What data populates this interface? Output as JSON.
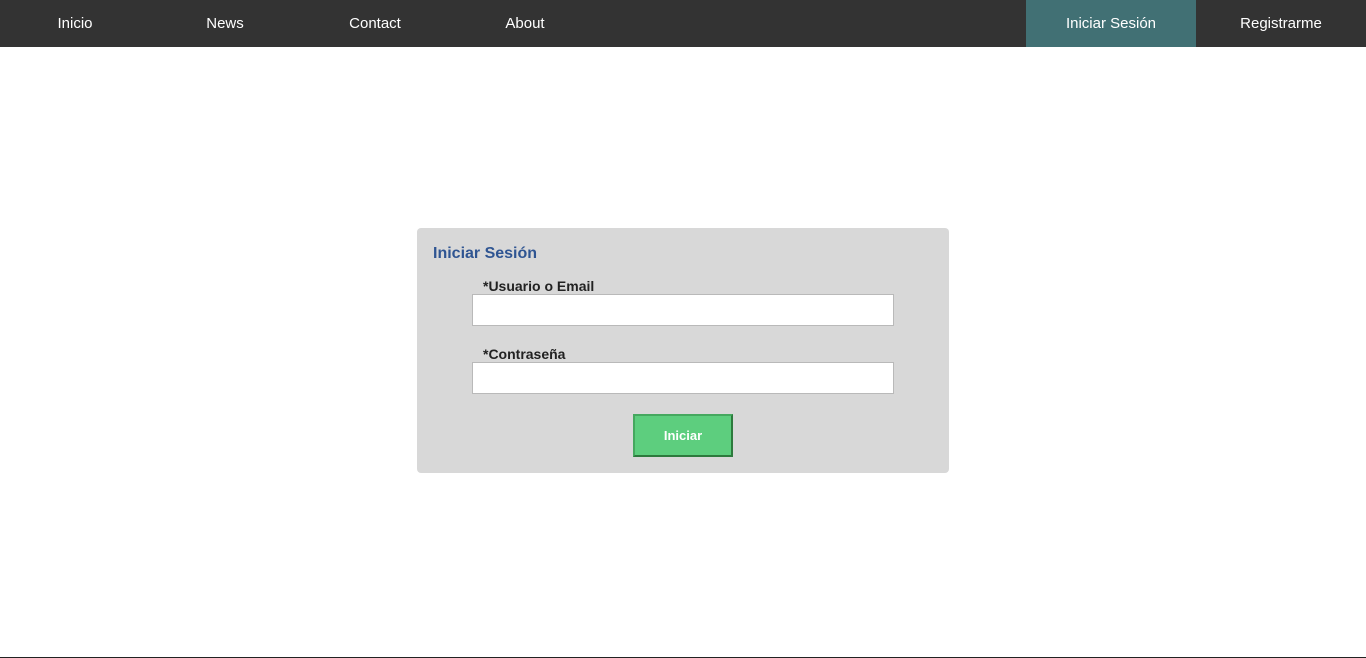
{
  "nav": {
    "left_items": [
      {
        "label": "Inicio"
      },
      {
        "label": "News"
      },
      {
        "label": "Contact"
      },
      {
        "label": "About"
      }
    ],
    "right_items": [
      {
        "label": "Iniciar Sesión",
        "active": true
      },
      {
        "label": "Registrarme",
        "active": false
      }
    ]
  },
  "login": {
    "title": "Iniciar Sesión",
    "user_label": "*Usuario o Email",
    "user_value": "",
    "password_label": "*Contraseña",
    "password_value": "",
    "submit_label": "Iniciar"
  },
  "colors": {
    "nav_bg": "#333333",
    "nav_active_bg": "#417074",
    "card_bg": "#d8d8d8",
    "title_color": "#2f5592",
    "button_bg": "#5dce7e"
  }
}
